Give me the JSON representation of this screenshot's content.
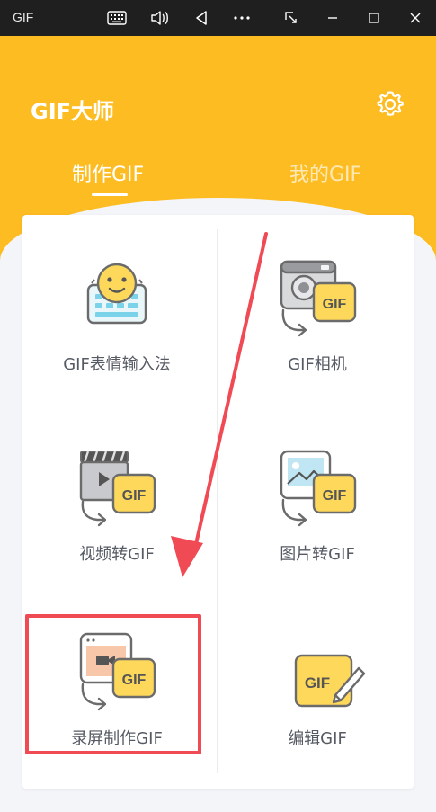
{
  "titlebar": {
    "app_name": "GIF",
    "icons": [
      "keyboard-icon",
      "volume-icon",
      "back-icon",
      "more-icon",
      "snip-icon",
      "minimize-icon",
      "maximize-icon",
      "close-icon"
    ]
  },
  "header": {
    "title": "GIF大师",
    "settings_icon": "gear-icon",
    "tabs": [
      {
        "label": "制作GIF",
        "active": true
      },
      {
        "label": "我的GIF",
        "active": false
      }
    ]
  },
  "features": [
    {
      "label": "GIF表情输入法",
      "icon": "emoji-keyboard-icon"
    },
    {
      "label": "GIF相机",
      "icon": "camera-gif-icon"
    },
    {
      "label": "视频转GIF",
      "icon": "video-to-gif-icon"
    },
    {
      "label": "图片转GIF",
      "icon": "image-to-gif-icon"
    },
    {
      "label": "录屏制作GIF",
      "icon": "screen-record-gif-icon",
      "highlighted": true
    },
    {
      "label": "编辑GIF",
      "icon": "edit-gif-icon"
    }
  ],
  "badge_text": "GIF",
  "colors": {
    "accent": "#fdbc21",
    "badge": "#fdd85a",
    "highlight": "#f04a55",
    "titlebar": "#1f1f1f"
  }
}
